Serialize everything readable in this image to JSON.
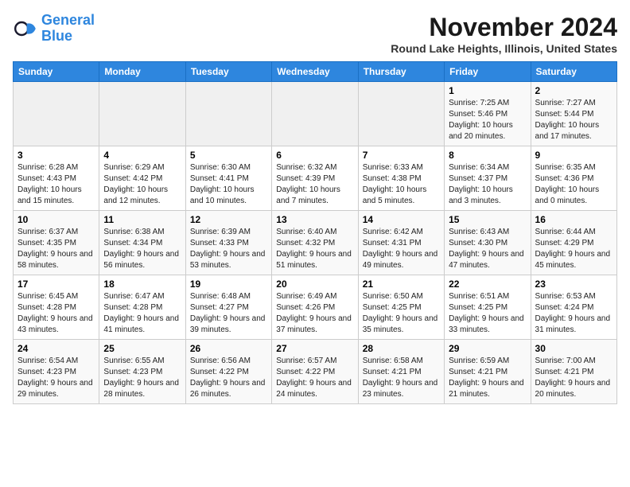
{
  "logo": {
    "line1": "General",
    "line2": "Blue"
  },
  "title": "November 2024",
  "subtitle": "Round Lake Heights, Illinois, United States",
  "weekdays": [
    "Sunday",
    "Monday",
    "Tuesday",
    "Wednesday",
    "Thursday",
    "Friday",
    "Saturday"
  ],
  "weeks": [
    [
      {
        "day": "",
        "info": ""
      },
      {
        "day": "",
        "info": ""
      },
      {
        "day": "",
        "info": ""
      },
      {
        "day": "",
        "info": ""
      },
      {
        "day": "",
        "info": ""
      },
      {
        "day": "1",
        "info": "Sunrise: 7:25 AM\nSunset: 5:46 PM\nDaylight: 10 hours and 20 minutes."
      },
      {
        "day": "2",
        "info": "Sunrise: 7:27 AM\nSunset: 5:44 PM\nDaylight: 10 hours and 17 minutes."
      }
    ],
    [
      {
        "day": "3",
        "info": "Sunrise: 6:28 AM\nSunset: 4:43 PM\nDaylight: 10 hours and 15 minutes."
      },
      {
        "day": "4",
        "info": "Sunrise: 6:29 AM\nSunset: 4:42 PM\nDaylight: 10 hours and 12 minutes."
      },
      {
        "day": "5",
        "info": "Sunrise: 6:30 AM\nSunset: 4:41 PM\nDaylight: 10 hours and 10 minutes."
      },
      {
        "day": "6",
        "info": "Sunrise: 6:32 AM\nSunset: 4:39 PM\nDaylight: 10 hours and 7 minutes."
      },
      {
        "day": "7",
        "info": "Sunrise: 6:33 AM\nSunset: 4:38 PM\nDaylight: 10 hours and 5 minutes."
      },
      {
        "day": "8",
        "info": "Sunrise: 6:34 AM\nSunset: 4:37 PM\nDaylight: 10 hours and 3 minutes."
      },
      {
        "day": "9",
        "info": "Sunrise: 6:35 AM\nSunset: 4:36 PM\nDaylight: 10 hours and 0 minutes."
      }
    ],
    [
      {
        "day": "10",
        "info": "Sunrise: 6:37 AM\nSunset: 4:35 PM\nDaylight: 9 hours and 58 minutes."
      },
      {
        "day": "11",
        "info": "Sunrise: 6:38 AM\nSunset: 4:34 PM\nDaylight: 9 hours and 56 minutes."
      },
      {
        "day": "12",
        "info": "Sunrise: 6:39 AM\nSunset: 4:33 PM\nDaylight: 9 hours and 53 minutes."
      },
      {
        "day": "13",
        "info": "Sunrise: 6:40 AM\nSunset: 4:32 PM\nDaylight: 9 hours and 51 minutes."
      },
      {
        "day": "14",
        "info": "Sunrise: 6:42 AM\nSunset: 4:31 PM\nDaylight: 9 hours and 49 minutes."
      },
      {
        "day": "15",
        "info": "Sunrise: 6:43 AM\nSunset: 4:30 PM\nDaylight: 9 hours and 47 minutes."
      },
      {
        "day": "16",
        "info": "Sunrise: 6:44 AM\nSunset: 4:29 PM\nDaylight: 9 hours and 45 minutes."
      }
    ],
    [
      {
        "day": "17",
        "info": "Sunrise: 6:45 AM\nSunset: 4:28 PM\nDaylight: 9 hours and 43 minutes."
      },
      {
        "day": "18",
        "info": "Sunrise: 6:47 AM\nSunset: 4:28 PM\nDaylight: 9 hours and 41 minutes."
      },
      {
        "day": "19",
        "info": "Sunrise: 6:48 AM\nSunset: 4:27 PM\nDaylight: 9 hours and 39 minutes."
      },
      {
        "day": "20",
        "info": "Sunrise: 6:49 AM\nSunset: 4:26 PM\nDaylight: 9 hours and 37 minutes."
      },
      {
        "day": "21",
        "info": "Sunrise: 6:50 AM\nSunset: 4:25 PM\nDaylight: 9 hours and 35 minutes."
      },
      {
        "day": "22",
        "info": "Sunrise: 6:51 AM\nSunset: 4:25 PM\nDaylight: 9 hours and 33 minutes."
      },
      {
        "day": "23",
        "info": "Sunrise: 6:53 AM\nSunset: 4:24 PM\nDaylight: 9 hours and 31 minutes."
      }
    ],
    [
      {
        "day": "24",
        "info": "Sunrise: 6:54 AM\nSunset: 4:23 PM\nDaylight: 9 hours and 29 minutes."
      },
      {
        "day": "25",
        "info": "Sunrise: 6:55 AM\nSunset: 4:23 PM\nDaylight: 9 hours and 28 minutes."
      },
      {
        "day": "26",
        "info": "Sunrise: 6:56 AM\nSunset: 4:22 PM\nDaylight: 9 hours and 26 minutes."
      },
      {
        "day": "27",
        "info": "Sunrise: 6:57 AM\nSunset: 4:22 PM\nDaylight: 9 hours and 24 minutes."
      },
      {
        "day": "28",
        "info": "Sunrise: 6:58 AM\nSunset: 4:21 PM\nDaylight: 9 hours and 23 minutes."
      },
      {
        "day": "29",
        "info": "Sunrise: 6:59 AM\nSunset: 4:21 PM\nDaylight: 9 hours and 21 minutes."
      },
      {
        "day": "30",
        "info": "Sunrise: 7:00 AM\nSunset: 4:21 PM\nDaylight: 9 hours and 20 minutes."
      }
    ]
  ]
}
